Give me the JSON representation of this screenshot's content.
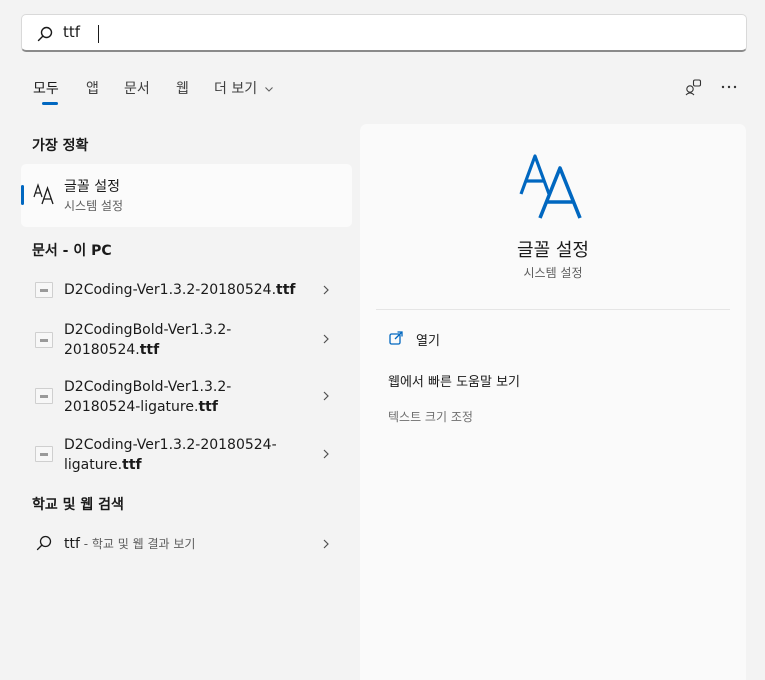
{
  "search": {
    "query": "ttf"
  },
  "tabs": [
    {
      "label": "모두",
      "active": true
    },
    {
      "label": "앱"
    },
    {
      "label": "문서"
    },
    {
      "label": "웹"
    },
    {
      "label": "더 보기"
    }
  ],
  "sections": {
    "best_match": "가장 정확",
    "documents": "문서 - 이 PC",
    "web": "학교 및 웹 검색"
  },
  "best_match": {
    "title": "글꼴 설정",
    "subtitle": "시스템 설정"
  },
  "documents": [
    {
      "line1": "D2Coding-Ver1.3.2-20180524.",
      "ext": "ttf",
      "line2": ""
    },
    {
      "line1": "D2CodingBold-Ver1.3.2-",
      "line2": "20180524.",
      "ext": "ttf"
    },
    {
      "line1": "D2CodingBold-Ver1.3.2-",
      "line2": "20180524-ligature.",
      "ext": "ttf"
    },
    {
      "line1": "D2Coding-Ver1.3.2-20180524-",
      "line2": "ligature.",
      "ext": "ttf"
    }
  ],
  "web_search": {
    "query": "ttf",
    "suffix": " - 학교 및 웹 결과 보기"
  },
  "detail": {
    "title": "글꼴 설정",
    "subtitle": "시스템 설정",
    "actions": [
      {
        "label": "열기"
      },
      {
        "label": "웹에서 빠른 도움말 보기"
      },
      {
        "label": "텍스트 크기 조정"
      }
    ]
  },
  "colors": {
    "accent": "#0067c0",
    "background": "#f3f3f3"
  }
}
